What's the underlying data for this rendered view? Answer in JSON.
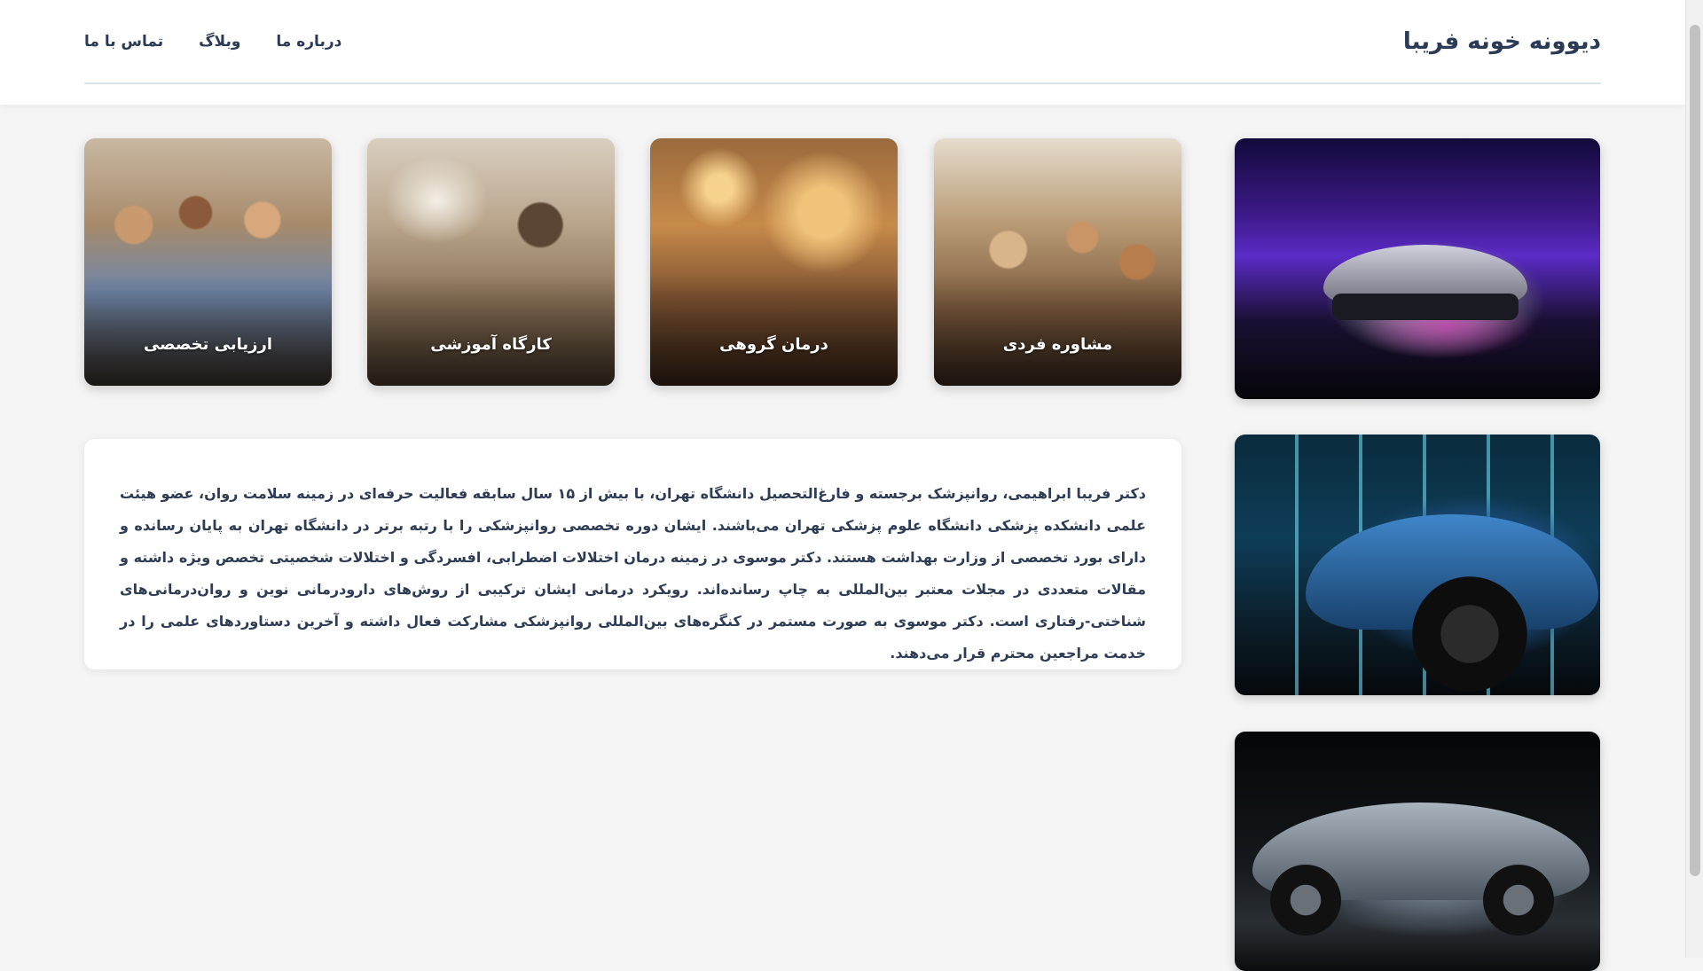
{
  "header": {
    "site_title": "دیوونه خونه فریبا",
    "nav": [
      "درباره ما",
      "وبلاگ",
      "تماس با ما"
    ]
  },
  "services": [
    {
      "label": "مشاوره فردی"
    },
    {
      "label": "درمان گروهی"
    },
    {
      "label": "کارگاه آموزشی"
    },
    {
      "label": "ارزیابی تخصصی"
    }
  ],
  "bio": {
    "text": "دکتر فریبا ابراهیمی، روانپزشک برجسته و فارغ‌التحصیل دانشگاه تهران، با بیش از ۱۵ سال سابقه فعالیت حرفه‌ای در زمینه سلامت روان، عضو هیئت علمی دانشکده پزشکی دانشگاه علوم پزشکی تهران می‌باشند. ایشان دوره تخصصی روانپزشکی را با رتبه برتر در دانشگاه تهران به پایان رسانده و دارای بورد تخصصی از وزارت بهداشت هستند. دکتر موسوی در زمینه درمان اختلالات اضطرابی، افسردگی و اختلالات شخصیتی تخصص ویژه داشته و مقالات متعددی در مجلات معتبر بین‌المللی به چاپ رسانده‌اند. رویکرد درمانی ایشان ترکیبی از روش‌های دارودرمانی نوین و روان‌درمانی‌های شناختی-رفتاری است. دکتر موسوی به صورت مستمر در کنگره‌های بین‌المللی روانپزشکی مشارکت فعال داشته و آخرین دستاوردهای علمی را در خدمت مراجعین محترم قرار می‌دهند."
  }
}
